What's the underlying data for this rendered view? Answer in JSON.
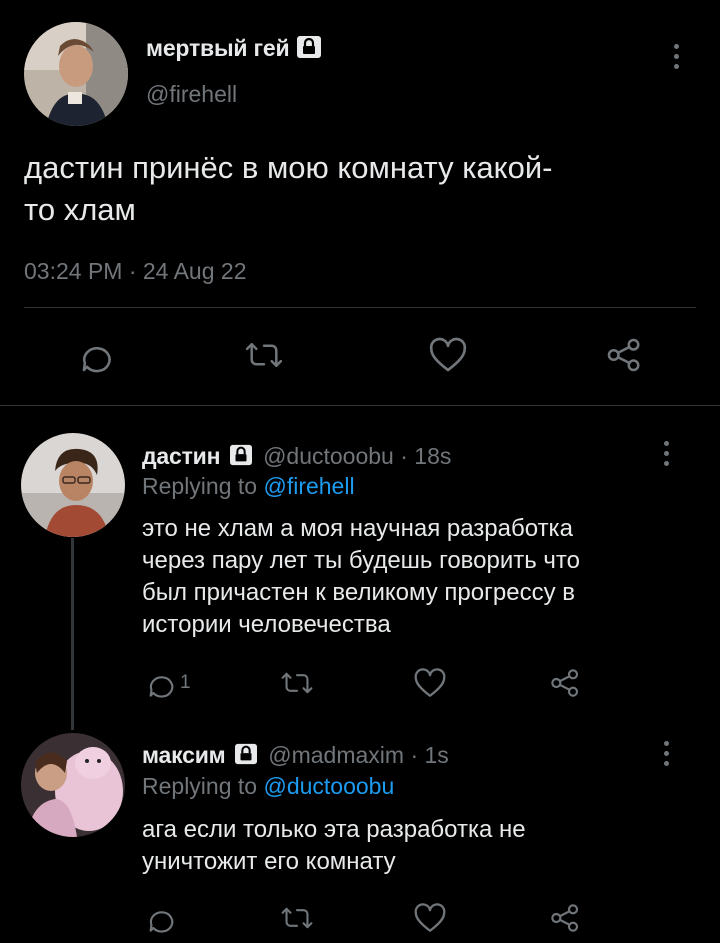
{
  "main_tweet": {
    "author_name": "мертвый гей",
    "author_handle": "@firehell",
    "text_line1": "дастин принёс в мою комнату какой-",
    "text_line2": "то хлам",
    "timestamp": "03:24 PM · 24 Aug 22"
  },
  "replies": [
    {
      "author_name": "дастин",
      "author_handle": "@ductooobu",
      "time": "· 18s",
      "replying_prefix": "Replying to",
      "replying_to": "@firehell",
      "lines": [
        "это не хлам а моя научная разработка",
        "через пару лет ты будешь говорить что",
        "был причастен к великому прогрессу в",
        "истории человечества"
      ],
      "reply_count": "1"
    },
    {
      "author_name": "максим",
      "author_handle": "@madmaxim",
      "time": "· 1s",
      "replying_prefix": "Replying to",
      "replying_to": "@ductooobu",
      "lines": [
        "ага если только эта разработка не",
        "уничтожит его комнату"
      ],
      "reply_count": ""
    }
  ],
  "icons": {
    "lock": "lock-icon",
    "reply": "reply-icon",
    "retweet": "retweet-icon",
    "like": "heart-icon",
    "share": "share-icon",
    "more": "more-vertical-icon"
  },
  "colors": {
    "background": "#000000",
    "text": "#e7e9ea",
    "muted": "#71767b",
    "link": "#1d9bf0",
    "divider": "#2f3336"
  }
}
